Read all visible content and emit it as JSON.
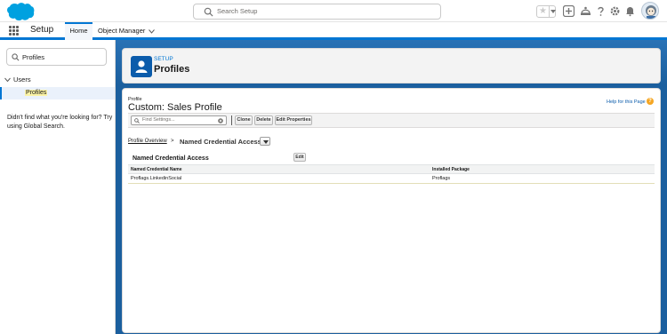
{
  "header": {
    "search_placeholder": "Search Setup",
    "icons": [
      "salesforce-cloud-logo",
      "star-icon",
      "add-icon",
      "trailhead-icon",
      "help-icon",
      "gear-icon",
      "bell-icon",
      "avatar"
    ]
  },
  "context_nav": {
    "app_name": "Setup",
    "tabs": [
      {
        "label": "Home",
        "active": true
      },
      {
        "label": "Object Manager",
        "active": false
      }
    ]
  },
  "sidebar": {
    "quickfind_value": "Profiles",
    "tree_group": "Users",
    "tree_item": "Profiles",
    "help_text": "Didn't find what you're looking for? Try using Global Search."
  },
  "page_header": {
    "eyebrow": "SETUP",
    "title": "Profiles"
  },
  "content": {
    "eyebrow": "Profile",
    "title": "Custom: Sales Profile",
    "help_link": "Help for this Page",
    "find_placeholder": "Find Settings...",
    "buttons": [
      "Clone",
      "Delete",
      "Edit Properties"
    ],
    "breadcrumb_link": "Profile Overview",
    "breadcrumb_sep": ">",
    "breadcrumb_current": "Named Credential Access",
    "section_title": "Named Credential Access",
    "section_edit": "Edit",
    "table": {
      "headers": [
        "Named Credential Name",
        "Installed Package"
      ],
      "rows": [
        [
          "Proflags.LinkedinSocial",
          "Proflags"
        ]
      ]
    }
  },
  "colors": {
    "brand_blue": "#0176d3",
    "background_blue": "#1b5f9e",
    "highlight_yellow": "#fbf3a5"
  }
}
